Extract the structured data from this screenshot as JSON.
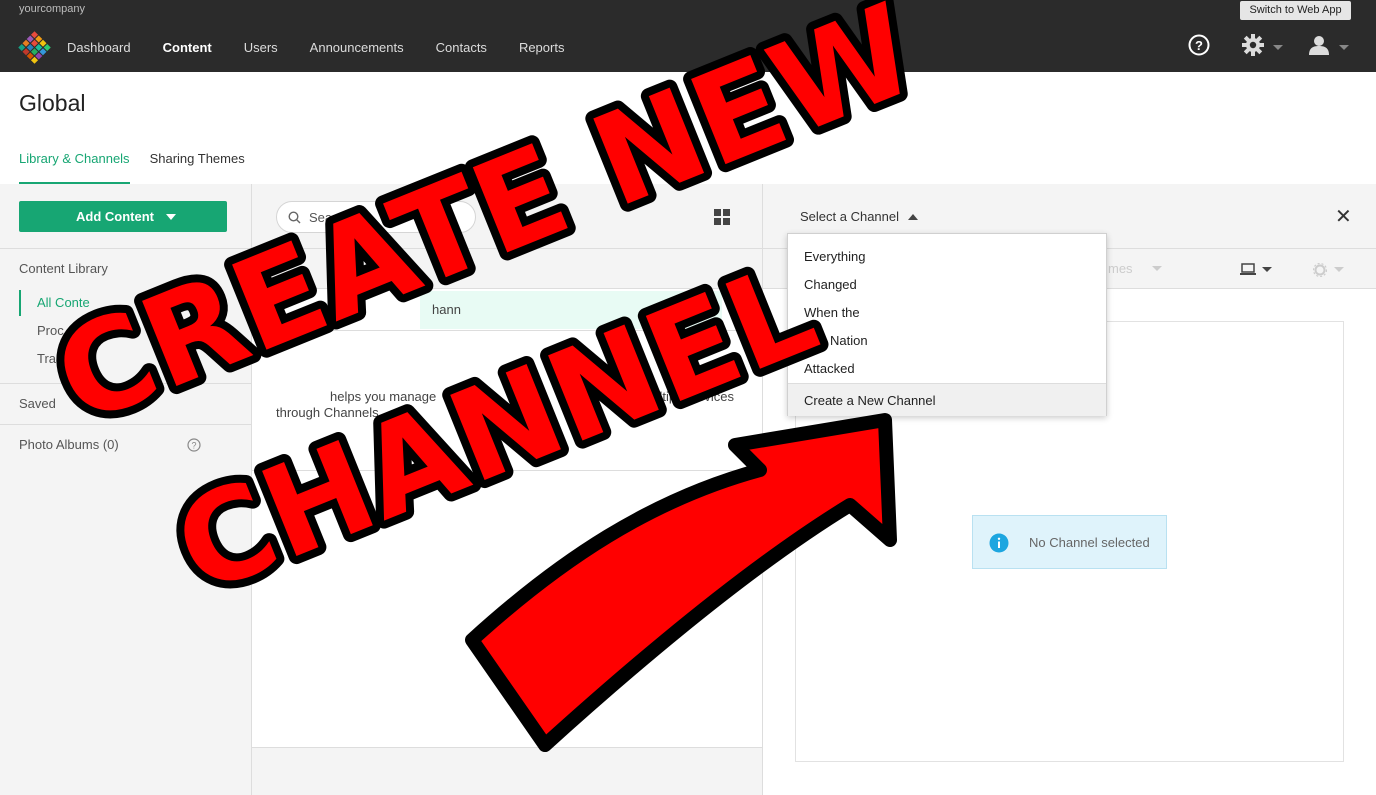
{
  "topbar": {
    "company": "yourcompany",
    "switch_label": "Switch to Web App",
    "nav": [
      "Dashboard",
      "Content",
      "Users",
      "Announcements",
      "Contacts",
      "Reports"
    ],
    "active_nav": "Content",
    "icons": [
      "help-icon",
      "gear-icon",
      "user-icon"
    ]
  },
  "header": {
    "title": "Global",
    "tabs": [
      "Library & Channels",
      "Sharing Themes"
    ]
  },
  "left": {
    "add_button": "Add Content",
    "section_title": "Content Library",
    "items": [
      "All Conte",
      "Proc",
      "Tra"
    ],
    "saved": "Saved",
    "photo_albums": "Photo Albums (0)"
  },
  "middle": {
    "search_placeholder": "Search",
    "banner_fragment": "hann",
    "desc_line1": "helps you manage",
    "desc_line1b": "to multiple devices",
    "desc_line2": "through Channels"
  },
  "right": {
    "select_label": "Select a Channel",
    "themes_fragment": "mes",
    "no_channel": "No Channel selected",
    "dropdown": {
      "items": [
        "Everything",
        "Changed",
        "When the",
        "Fire Nation",
        "Attacked"
      ],
      "create": "Create a New Channel"
    }
  },
  "overlay": {
    "line1": "CREATE NEW",
    "line2": "CHANNEL"
  },
  "colors": {
    "accent": "#17a673",
    "topbar": "#2b2b2b",
    "overlay_red": "#ff0000",
    "info_blue": "#1da6e0"
  }
}
